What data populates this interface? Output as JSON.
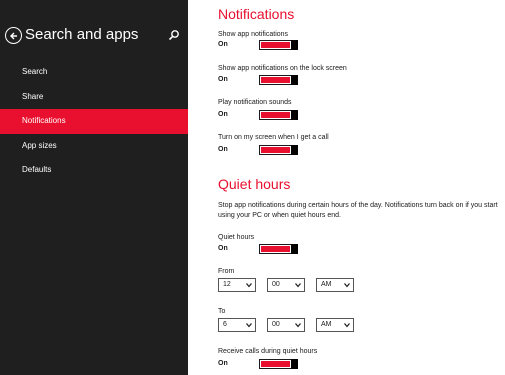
{
  "sidebar": {
    "title": "Search and apps",
    "items": [
      {
        "label": "Search"
      },
      {
        "label": "Share"
      },
      {
        "label": "Notifications",
        "active": true
      },
      {
        "label": "App sizes"
      },
      {
        "label": "Defaults"
      }
    ]
  },
  "notifications": {
    "title": "Notifications",
    "settings": [
      {
        "label": "Show app notifications",
        "state": "On",
        "level": 1
      },
      {
        "label": "Show app notifications on the lock screen",
        "state": "On",
        "level": 1
      },
      {
        "label": "Play notification sounds",
        "state": "On",
        "level": 1
      },
      {
        "label": "Turn on my screen when I get a call",
        "state": "On",
        "level": 1
      }
    ]
  },
  "quiet_hours": {
    "title": "Quiet hours",
    "description": "Stop app notifications during certain hours of the day. Notifications turn back on if you start using your PC or when quiet hours end.",
    "toggle": {
      "label": "Quiet hours",
      "state": "On",
      "level": 1
    },
    "from": {
      "label": "From",
      "hour": "12",
      "minute": "00",
      "period": "AM"
    },
    "to": {
      "label": "To",
      "hour": "6",
      "minute": "00",
      "period": "AM"
    },
    "calls": {
      "label": "Receive calls during quiet hours",
      "state": "On",
      "level": 1
    }
  },
  "colors": {
    "accent": "#e8102e",
    "sidebar_bg": "#1f1f1f"
  }
}
